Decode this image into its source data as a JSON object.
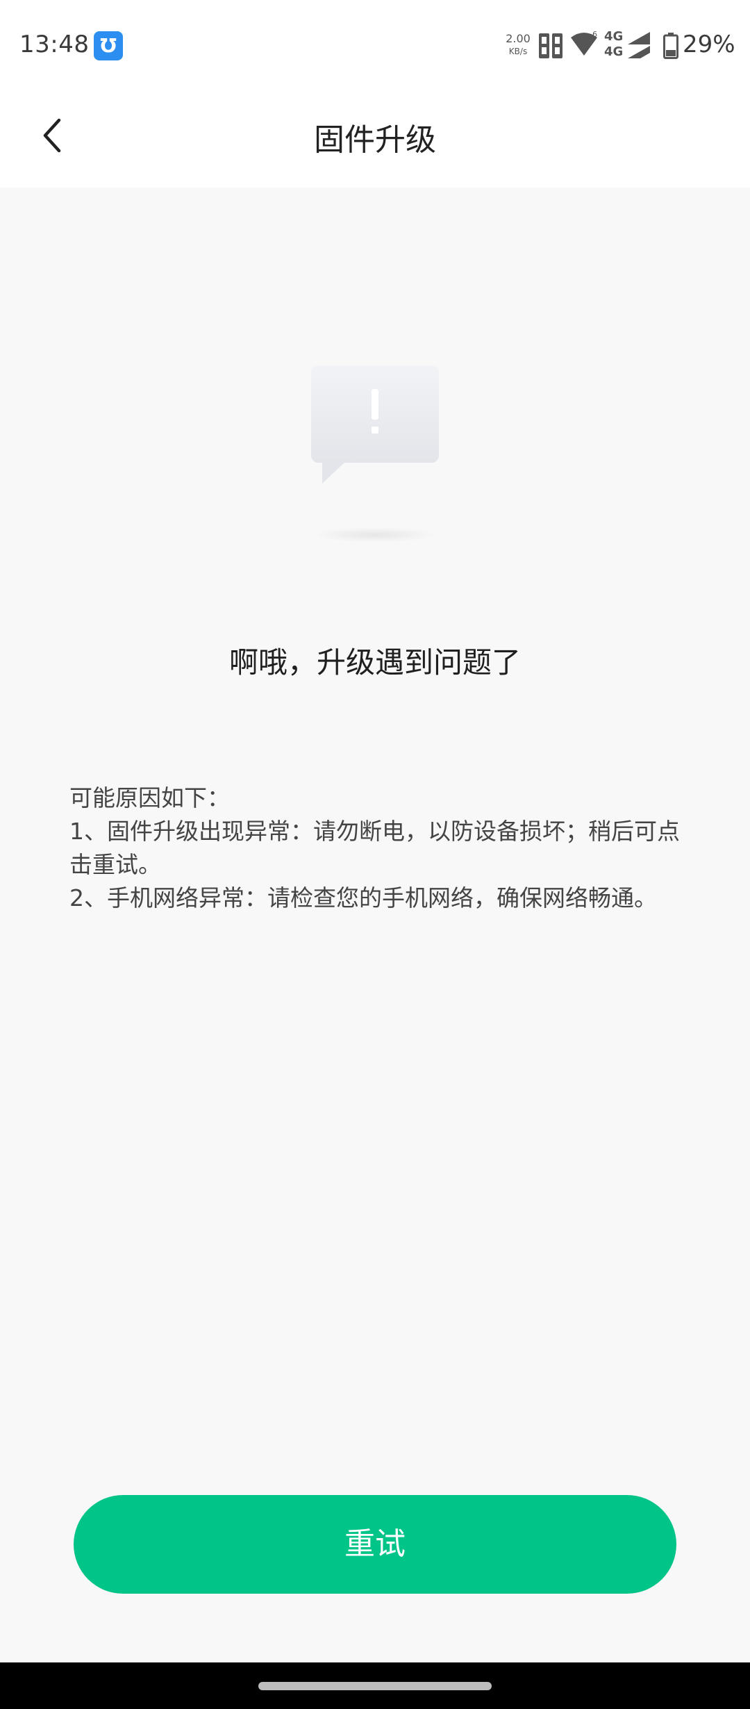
{
  "status_bar": {
    "time": "13:48",
    "app_icon_glyph": "Ʊ",
    "net_speed_value": "2.00",
    "net_speed_unit": "KB/s",
    "cell_label_top": "4G",
    "cell_label_bottom": "4G",
    "battery_percent": "29%"
  },
  "header": {
    "title": "固件升级"
  },
  "main": {
    "error_heading": "啊哦，升级遇到问题了",
    "reasons": [
      "可能原因如下：",
      "1、固件升级出现异常：请勿断电，以防设备损坏；稍后可点击重试。",
      "2、手机网络异常：请检查您的手机网络，确保网络畅通。"
    ]
  },
  "actions": {
    "retry_label": "重试"
  },
  "colors": {
    "accent": "#00c488",
    "background": "#f8f8f8"
  },
  "icons": [
    "back-chevron-icon",
    "alert-bubble-icon",
    "wifi-icon",
    "signal-icon",
    "battery-icon",
    "sim-card-icon"
  ]
}
